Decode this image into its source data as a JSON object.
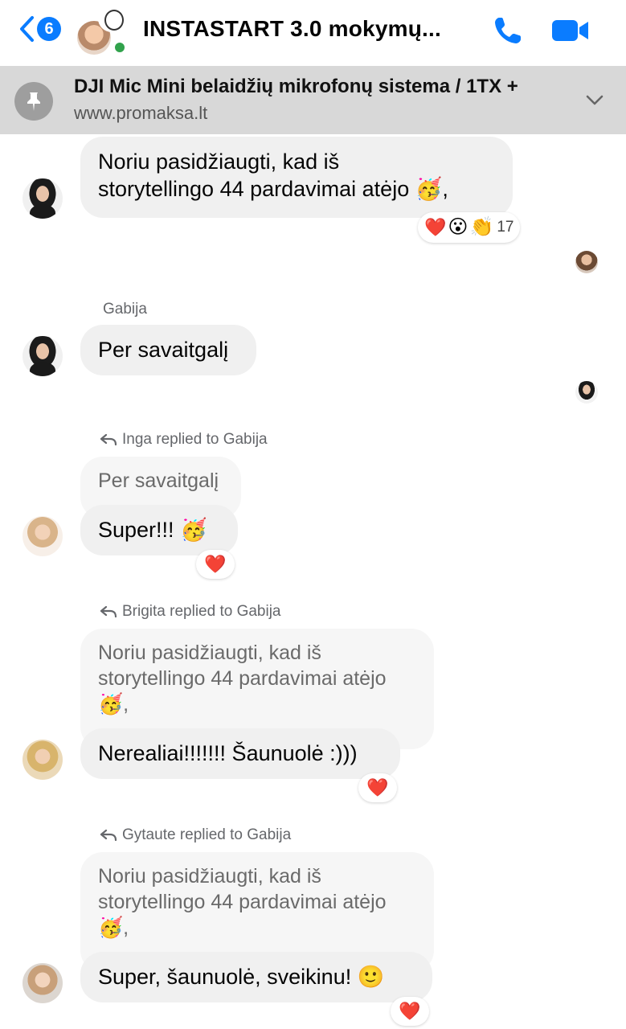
{
  "header": {
    "unread_count": "6",
    "title": "INSTASTART 3.0 mokymų..."
  },
  "pinned": {
    "title": "DJI Mic Mini belaidžių mikrofonų sistema / 1TX +",
    "url": "www.promaksa.lt"
  },
  "messages": {
    "m1": {
      "line1": "Noriu pasidžiaugti, kad iš",
      "line2": "storytellingo 44 pardavimai atėjo 🥳,",
      "reactions": {
        "e1": "❤️",
        "e2": "😮",
        "e3": "👏",
        "count": "17"
      }
    },
    "m2": {
      "sender": "Gabija",
      "text": "Per savaitgalį"
    },
    "m3": {
      "replied": "Inga replied to Gabija",
      "quote": "Per savaitgalį",
      "text": "Super!!! 🥳",
      "reaction": "❤️"
    },
    "m4": {
      "replied": "Brigita replied to Gabija",
      "quote1": "Noriu pasidžiaugti, kad iš",
      "quote2": "storytellingo 44 pardavimai atėjo",
      "quote3": "🥳,",
      "text": "Nerealiai!!!!!!! Šaunuolė :)))",
      "reaction": "❤️"
    },
    "m5": {
      "replied": "Gytaute replied to Gabija",
      "quote1": "Noriu pasidžiaugti, kad iš",
      "quote2": "storytellingo 44 pardavimai atėjo",
      "quote3": "🥳,",
      "text": "Super, šaunuolė, sveikinu! 🙂",
      "reaction": "❤️"
    }
  },
  "colors": {
    "accent": "#0a7cff",
    "online": "#31a24c",
    "bubble": "#f0f0f0",
    "pinned_bg": "#d8d8d8"
  }
}
